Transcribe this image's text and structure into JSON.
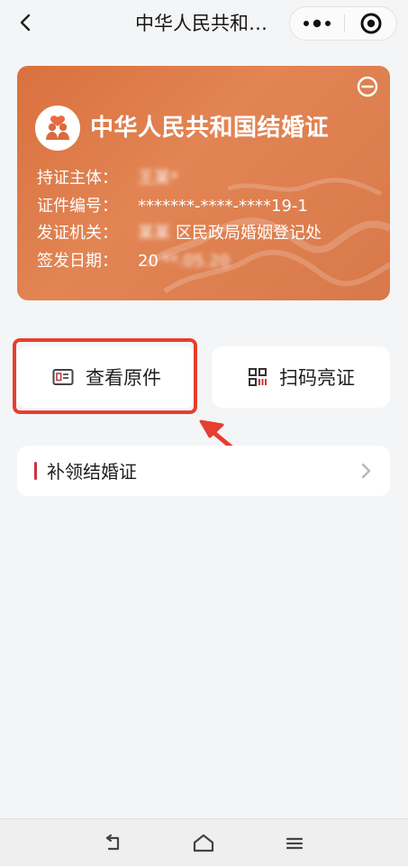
{
  "nav": {
    "title": "中华人民共和…",
    "back_icon": "chevron-left-icon",
    "more_icon": "more-dots-icon",
    "close_icon": "target-close-icon"
  },
  "card": {
    "title": "中华人民共和国结婚证",
    "fields": [
      {
        "label": "持证主体：",
        "value": "王某*"
      },
      {
        "label": "证件编号：",
        "value": "*******-****-****19-1"
      },
      {
        "label": "发证机关：",
        "value_blur": "某某",
        "value": "区民政局婚姻登记处"
      },
      {
        "label": "签发日期：",
        "value": "20",
        "value_blur": "**.05.20"
      }
    ],
    "gradient": [
      "#d9713e",
      "#e28453",
      "#d8794b"
    ]
  },
  "actions": {
    "view_original": "查看原件",
    "scan_show": "扫码亮证"
  },
  "reissue": {
    "label": "补领结婚证"
  },
  "colors": {
    "highlight": "#e53f2f",
    "accent": "#c7353d"
  },
  "bottom_nav": {
    "back_icon": "back-icon",
    "home_icon": "home-icon",
    "menu_icon": "menu-icon"
  }
}
